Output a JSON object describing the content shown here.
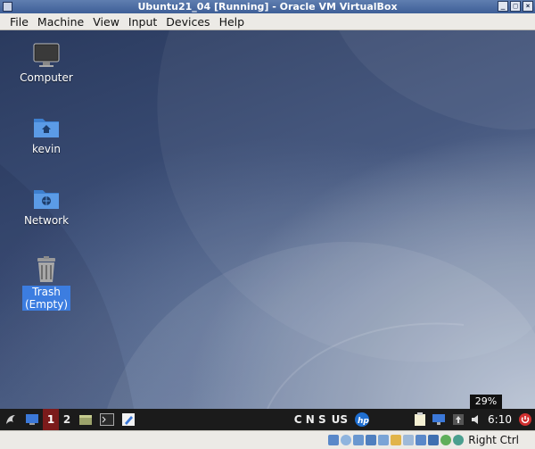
{
  "window": {
    "title": "Ubuntu21_04 [Running] - Oracle VM VirtualBox",
    "buttons": [
      "minimize",
      "maximize",
      "close"
    ]
  },
  "menu": [
    "File",
    "Machine",
    "View",
    "Input",
    "Devices",
    "Help"
  ],
  "desktop_icons": [
    {
      "label": "Computer",
      "icon": "monitor-icon"
    },
    {
      "label": "kevin",
      "icon": "home-folder-icon"
    },
    {
      "label": "Network",
      "icon": "network-folder-icon"
    },
    {
      "label": "Trash\n(Empty)",
      "icon": "trash-icon",
      "selected": true
    }
  ],
  "taskbar": {
    "workspaces": [
      "1",
      "2"
    ],
    "active_workspace": "1",
    "tray_text": "C N S",
    "keyboard_layout": "US",
    "volume_tooltip": "29%",
    "clock": "6:10",
    "icons": [
      "app-menu-icon",
      "show-desktop-icon",
      "file-manager-icon",
      "terminal-icon",
      "text-editor-icon",
      "hp-printer-icon",
      "clipboard-icon",
      "network-icon",
      "updates-icon",
      "volume-icon",
      "power-icon"
    ]
  },
  "statusbar": {
    "host_key": "Right Ctrl",
    "icons": [
      "hard-disk-icon",
      "optical-drive-icon",
      "audio-icon",
      "network-adapter-icon",
      "usb-icon",
      "shared-folders-icon",
      "display-icon",
      "video-capture-icon",
      "mouse-integration-icon",
      "cpu-icon",
      "keyboard-icon"
    ]
  }
}
